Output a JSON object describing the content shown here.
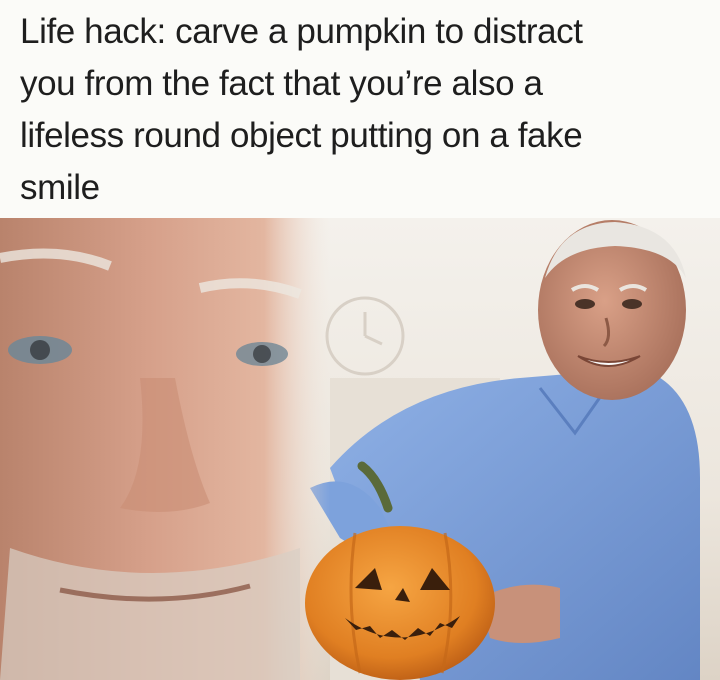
{
  "caption": {
    "text": "Life hack: carve a pumpkin to distract\nyou from the fact that you’re also a\nlifeless round object putting on a fake\nsmile"
  },
  "photo": {
    "description_icons": [
      "old-man-face-closeup",
      "smiling-man-blue-shirt",
      "jack-o-lantern-pumpkin"
    ],
    "colors": {
      "background": "#fbfbf8",
      "shirt": "#7a9fd8",
      "pumpkin": "#e58a2c",
      "skin": "#c98f74",
      "wall": "#eeeae3"
    }
  }
}
